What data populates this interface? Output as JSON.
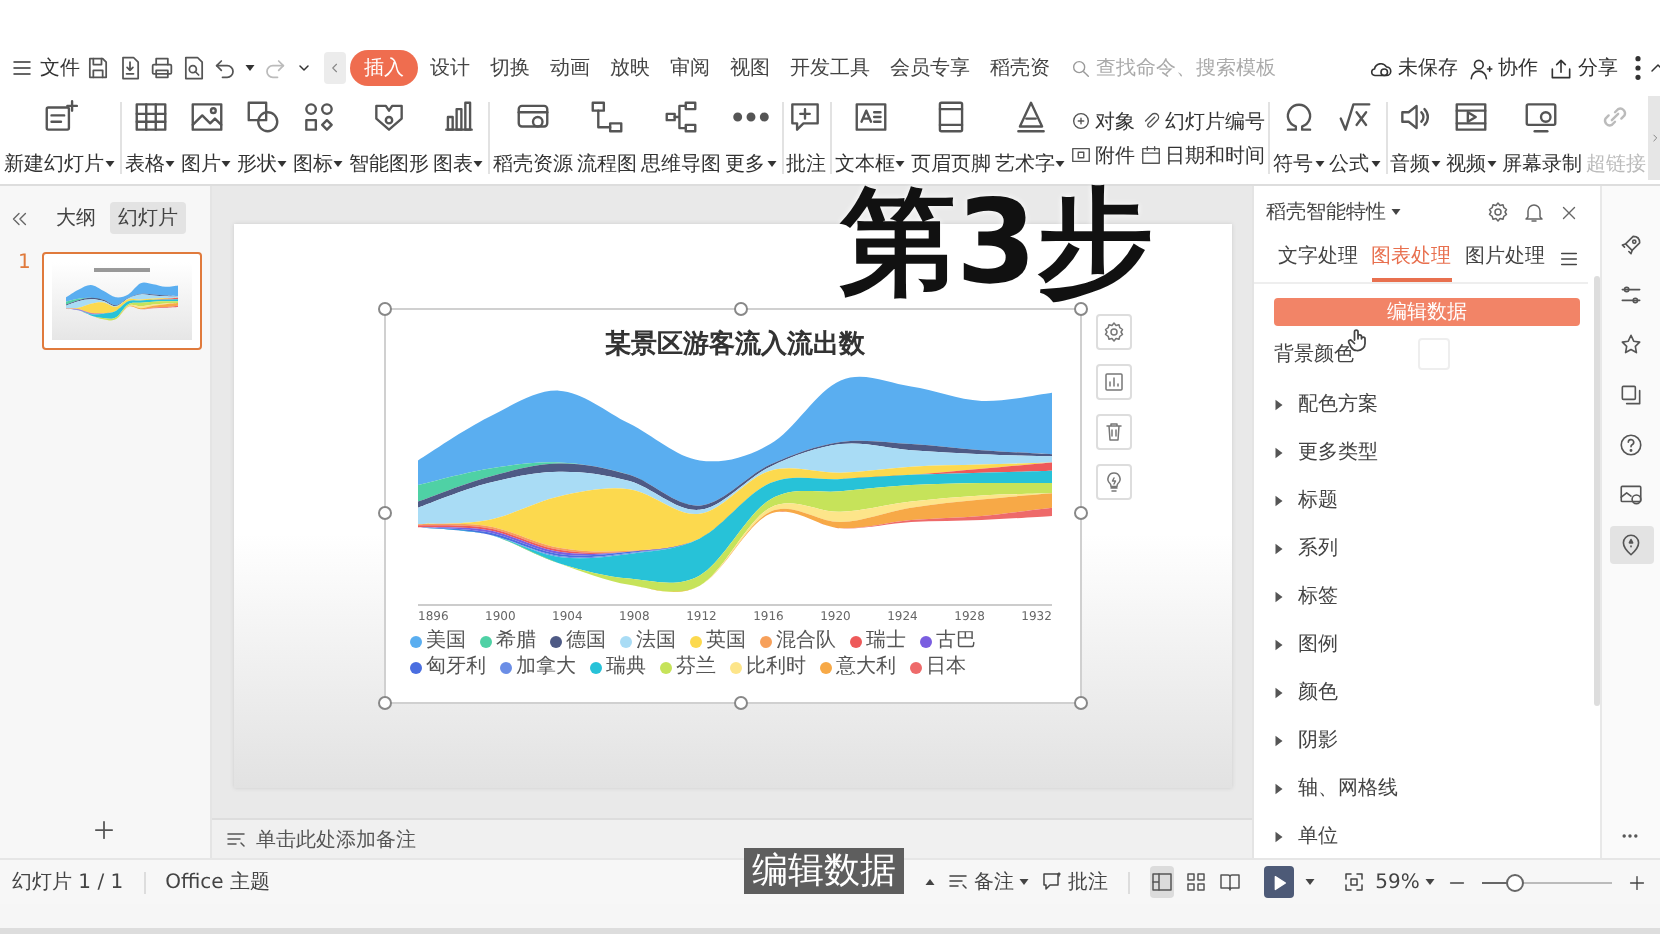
{
  "menubar": {
    "file_menu": "文件",
    "tabs": [
      {
        "label": "插入",
        "selected": true
      },
      {
        "label": "设计",
        "selected": false
      },
      {
        "label": "切换",
        "selected": false
      },
      {
        "label": "动画",
        "selected": false
      },
      {
        "label": "放映",
        "selected": false
      },
      {
        "label": "审阅",
        "selected": false
      },
      {
        "label": "视图",
        "selected": false
      },
      {
        "label": "开发工具",
        "selected": false
      },
      {
        "label": "会员专享",
        "selected": false
      },
      {
        "label": "稻壳资",
        "selected": false
      }
    ],
    "search": {
      "placeholder": "查找命令、搜索模板"
    },
    "actions": [
      {
        "label": "未保存"
      },
      {
        "label": "协作"
      },
      {
        "label": "分享"
      }
    ]
  },
  "ribbon": {
    "items": [
      {
        "kind": "large",
        "label": "新建幻灯片",
        "dropdown": true,
        "disabled": false
      },
      {
        "kind": "large",
        "label": "表格",
        "dropdown": true,
        "disabled": false
      },
      {
        "kind": "large",
        "label": "图片",
        "dropdown": true,
        "disabled": false
      },
      {
        "kind": "large",
        "label": "形状",
        "dropdown": true,
        "disabled": false
      },
      {
        "kind": "large",
        "label": "图标",
        "dropdown": true,
        "disabled": false
      },
      {
        "kind": "large",
        "label": "智能图形",
        "dropdown": false,
        "disabled": false
      },
      {
        "kind": "large",
        "label": "图表",
        "dropdown": true,
        "disabled": false
      },
      {
        "kind": "large",
        "label": "稻壳资源",
        "dropdown": false,
        "disabled": false
      },
      {
        "kind": "large",
        "label": "流程图",
        "dropdown": false,
        "disabled": false
      },
      {
        "kind": "large",
        "label": "思维导图",
        "dropdown": false,
        "disabled": false
      },
      {
        "kind": "large",
        "label": "更多",
        "dropdown": true,
        "disabled": false
      },
      {
        "kind": "large",
        "label": "批注",
        "dropdown": false,
        "disabled": false
      },
      {
        "kind": "large",
        "label": "文本框",
        "dropdown": true,
        "disabled": false
      },
      {
        "kind": "large",
        "label": "页眉页脚",
        "dropdown": false,
        "disabled": false
      },
      {
        "kind": "large",
        "label": "艺术字",
        "dropdown": true,
        "disabled": false
      },
      {
        "kind": "group",
        "items": [
          {
            "label": "对象",
            "dropdown": false,
            "disabled": false
          },
          {
            "label": "幻灯片编号",
            "dropdown": false,
            "disabled": false
          },
          {
            "label": "附件",
            "dropdown": false,
            "disabled": false
          },
          {
            "label": "日期和时间",
            "dropdown": false,
            "disabled": false
          }
        ]
      },
      {
        "kind": "large",
        "label": "符号",
        "dropdown": true,
        "disabled": false
      },
      {
        "kind": "large",
        "label": "公式",
        "dropdown": true,
        "disabled": false
      },
      {
        "kind": "large",
        "label": "音频",
        "dropdown": true,
        "disabled": false
      },
      {
        "kind": "large",
        "label": "视频",
        "dropdown": true,
        "disabled": false
      },
      {
        "kind": "large",
        "label": "屏幕录制",
        "dropdown": false,
        "disabled": false
      },
      {
        "kind": "large",
        "label": "超链接",
        "dropdown": false,
        "disabled": true
      }
    ]
  },
  "slides_panel": {
    "tabs": [
      {
        "label": "大纲",
        "selected": false
      },
      {
        "label": "幻灯片",
        "selected": true
      }
    ],
    "slides": [
      {
        "number": "1",
        "selected": true
      }
    ]
  },
  "slide": {
    "chart": {
      "title": "某景区游客流入流出数",
      "x_labels": [
        "1896",
        "1900",
        "1904",
        "1908",
        "1912",
        "1916",
        "1920",
        "1924",
        "1928",
        "1932"
      ],
      "legend": [
        {
          "label": "美国",
          "color": "#5aaef0"
        },
        {
          "label": "希腊",
          "color": "#4fd1a5"
        },
        {
          "label": "德国",
          "color": "#4e5a85"
        },
        {
          "label": "法国",
          "color": "#a9dcf5"
        },
        {
          "label": "英国",
          "color": "#fcd94e"
        },
        {
          "label": "混合队",
          "color": "#f7a05a"
        },
        {
          "label": "瑞士",
          "color": "#ee5a5a"
        },
        {
          "label": "古巴",
          "color": "#7a5ee0"
        },
        {
          "label": "匈牙利",
          "color": "#4a6ee0"
        },
        {
          "label": "加拿大",
          "color": "#6b8ee6"
        },
        {
          "label": "瑞典",
          "color": "#27c2d8"
        },
        {
          "label": "芬兰",
          "color": "#c6e35a"
        },
        {
          "label": "比利时",
          "color": "#fde58a"
        },
        {
          "label": "意大利",
          "color": "#f7a947"
        },
        {
          "label": "日本",
          "color": "#ee6a6a"
        }
      ]
    },
    "notes_placeholder": "单击此处添加备注"
  },
  "side_panel": {
    "title": "稻壳智能特性",
    "tabs": [
      {
        "label": "文字处理",
        "selected": false
      },
      {
        "label": "图表处理",
        "selected": true
      },
      {
        "label": "图片处理",
        "selected": false
      }
    ],
    "primary_button": "编辑数据",
    "background_label": "背景颜色",
    "sections": [
      {
        "label": "配色方案",
        "expanded": false
      },
      {
        "label": "更多类型",
        "expanded": false
      },
      {
        "label": "标题",
        "expanded": false
      },
      {
        "label": "系列",
        "expanded": false
      },
      {
        "label": "标签",
        "expanded": false
      },
      {
        "label": "图例",
        "expanded": false
      },
      {
        "label": "颜色",
        "expanded": false
      },
      {
        "label": "阴影",
        "expanded": false
      },
      {
        "label": "轴、网格线",
        "expanded": false
      },
      {
        "label": "单位",
        "expanded": false
      }
    ]
  },
  "right_rail": [
    {
      "selected": false
    },
    {
      "selected": false
    },
    {
      "selected": false
    },
    {
      "selected": false
    },
    {
      "selected": false
    },
    {
      "selected": false
    },
    {
      "selected": true
    }
  ],
  "status_bar": {
    "slide_counter": "幻灯片 1 / 1",
    "theme": "Office 主题",
    "notes": "备注",
    "comments": "批注",
    "views": [
      {
        "selected": true
      },
      {
        "selected": false
      },
      {
        "selected": false
      }
    ],
    "zoom": "59%",
    "zoom_slider": {
      "level": 0.25
    }
  },
  "overlays": {
    "step_caption": "第3步",
    "subtitle": "编辑数据"
  }
}
